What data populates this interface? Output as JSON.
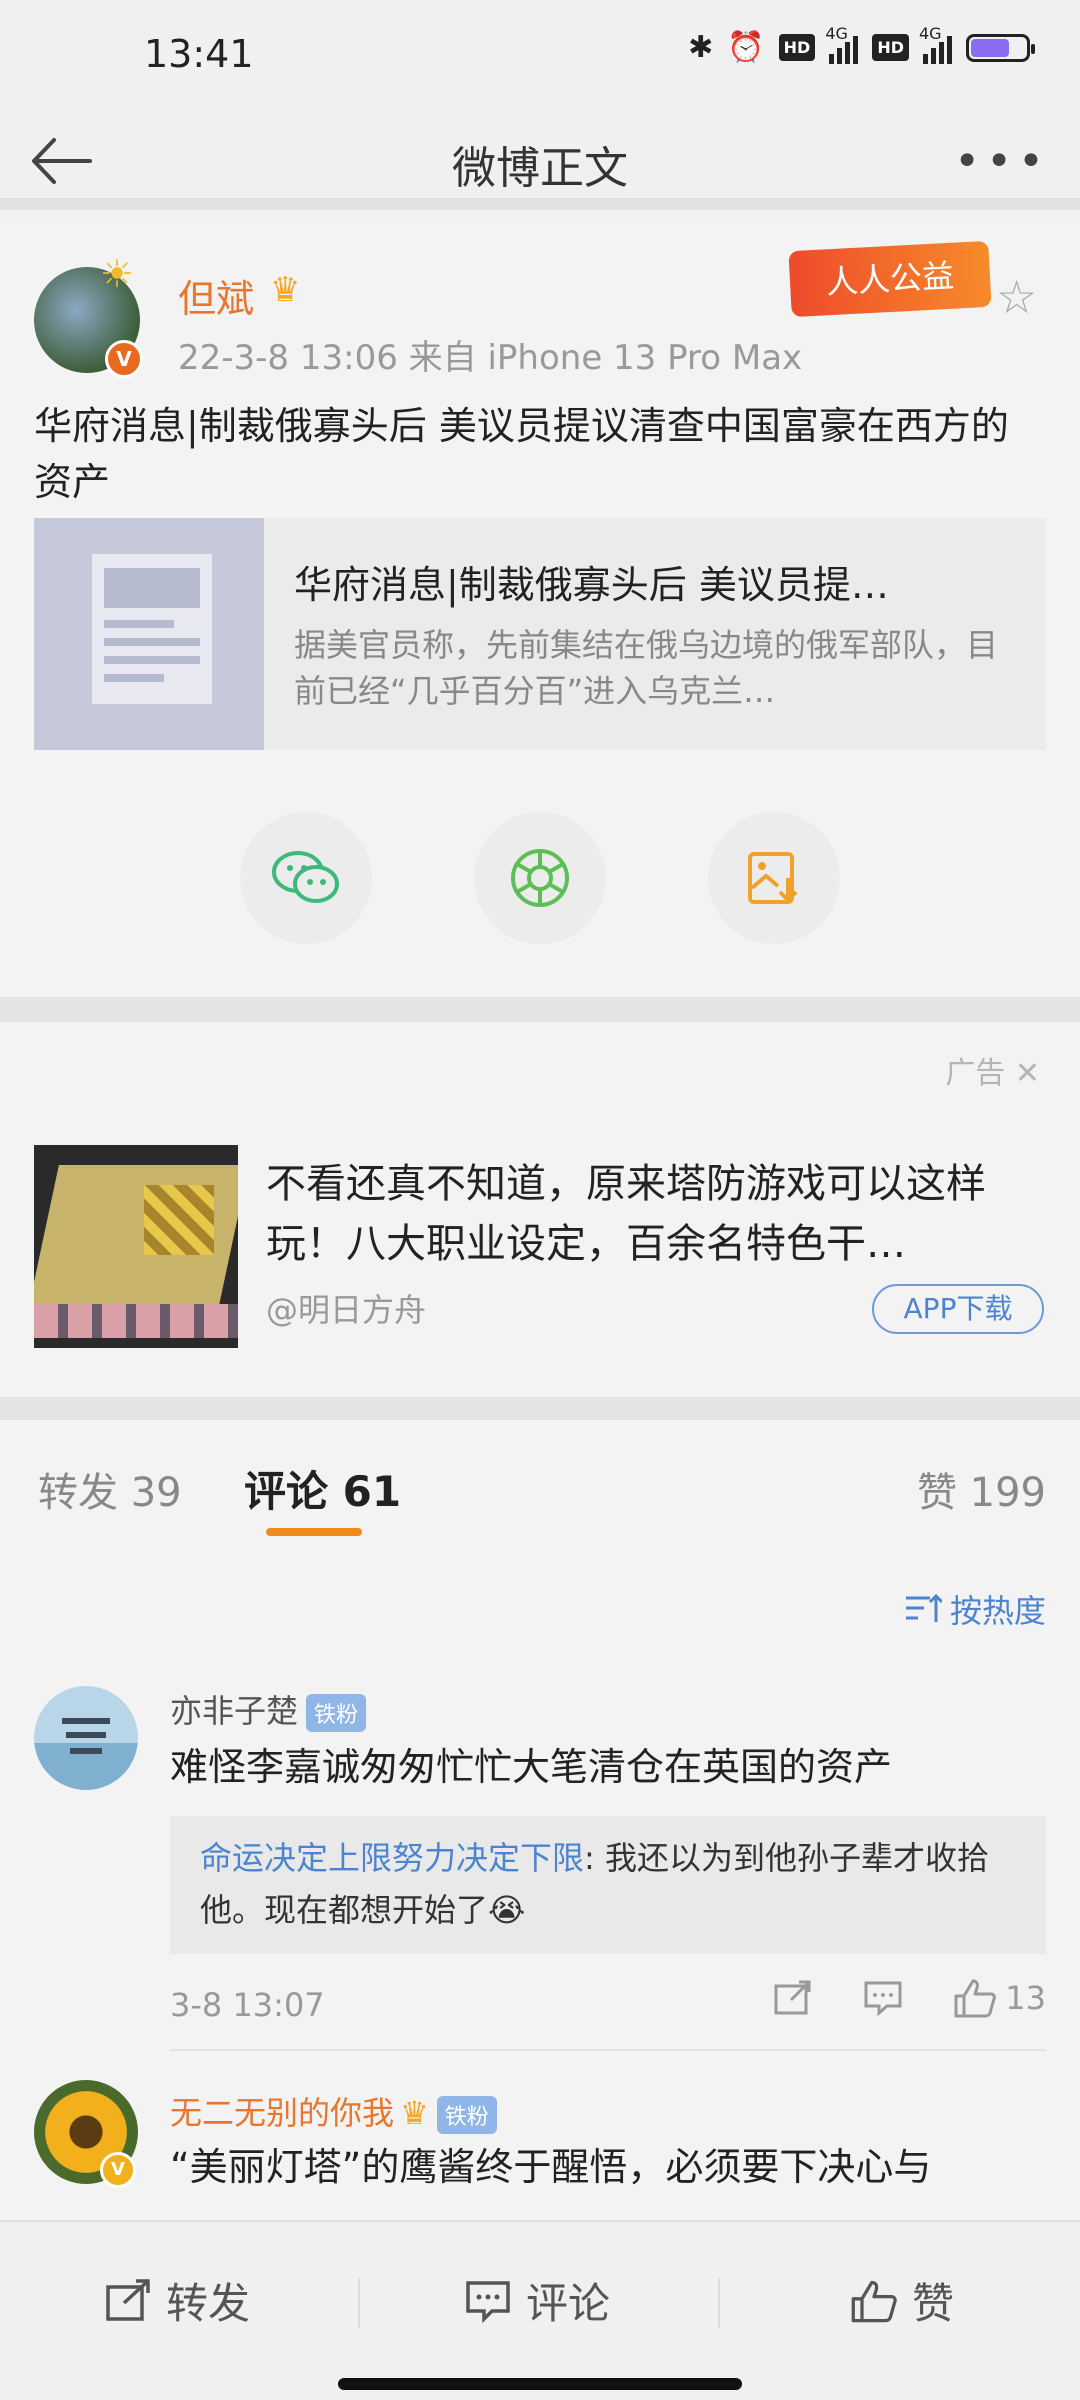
{
  "status_bar": {
    "time": "13:41",
    "network1": "4G",
    "network2": "4G",
    "hd1": "HD",
    "hd2": "HD",
    "battery_level": 0.71,
    "battery_label": "71"
  },
  "nav": {
    "title": "微博正文",
    "back_icon": "arrow-left-icon",
    "more_icon": "more-dots-icon"
  },
  "post": {
    "author": "但斌",
    "meta": "22-3-8 13:06  来自 iPhone 13 Pro Max",
    "badge": "人人公益",
    "verified_label": "V",
    "text": "华府消息|制裁俄寡头后 美议员提议清查中国富豪在西方的资产",
    "link_card": {
      "title": "华府消息|制裁俄寡头后 美议员提…",
      "description": "据美官员称，先前集结在俄乌边境的俄军部队，目前已经“几乎百分百”进入乌克兰…"
    },
    "share_icons": [
      "wechat-icon",
      "moments-icon",
      "save-image-icon"
    ]
  },
  "ad": {
    "label": "广告",
    "close_glyph": "✕",
    "text": "不看还真不知道，原来塔防游戏可以这样玩！八大职业设定，百余名特色干…",
    "source": "@明日方舟",
    "button": "APP下载"
  },
  "tabs": {
    "repost": "转发 39",
    "comment": "评论 61",
    "like": "赞 199"
  },
  "comments": {
    "sort_label": "按热度",
    "items": [
      {
        "name": "亦非子楚",
        "badge": "铁粉",
        "text": "难怪李嘉诚匆匆忙忙大笔清仓在英国的资产",
        "reply_user": "命运决定上限努力决定下限",
        "reply_text": ": 我还以为到他孙子辈才收拾他。现在都想开始了😭",
        "time": "3-8 13:07",
        "likes": "13"
      },
      {
        "name": "无二无别的你我",
        "badge": "铁粉",
        "verified_label": "V",
        "text": "“美丽灯塔”的鹰酱终于醒悟，必须要下决心与"
      }
    ]
  },
  "bottom_bar": {
    "repost": "转发",
    "comment": "评论",
    "like": "赞"
  },
  "colors": {
    "accent_orange": "#f08a1c",
    "link_blue": "#4d84cf",
    "name_orange": "#e8762c"
  }
}
